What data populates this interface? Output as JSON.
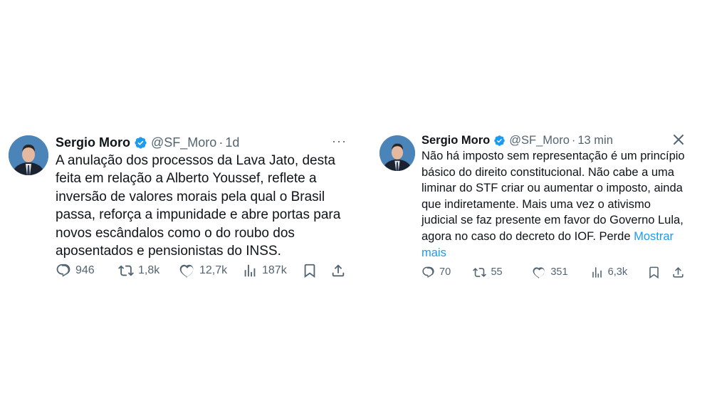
{
  "tweets": [
    {
      "author": {
        "name": "Sergio Moro",
        "handle": "@SF_Moro",
        "separator": "·",
        "time": "1d",
        "verified": true
      },
      "menu_label": "···",
      "text": "A anulação dos processos da Lava Jato, desta feita em relação a Alberto Youssef, reflete a inversão de valores morais pela qual o Brasil passa, reforça a impunidade e abre portas para novos escândalos como o do roubo dos aposentados e pensionistas do INSS.",
      "stats": {
        "replies": "946",
        "reposts": "1,8k",
        "likes": "12,7k",
        "views": "187k"
      }
    },
    {
      "author": {
        "name": "Sergio Moro",
        "handle": "@SF_Moro",
        "separator": "·",
        "time": "13 min",
        "verified": true
      },
      "close_icon": "close-icon",
      "text": "Não há imposto sem representação é um princípio básico do direito constitucional. Não cabe a uma liminar do STF criar ou aumentar o imposto, ainda que indiretamente. Mais uma vez o ativismo judicial se faz presente em favor do Governo Lula, agora no caso do decreto do IOF. Perde",
      "show_more": "Mostrar mais",
      "stats": {
        "replies": "70",
        "reposts": "55",
        "likes": "351",
        "views": "6,3k"
      }
    }
  ],
  "colors": {
    "text": "#0f1419",
    "secondary": "#536471",
    "verified": "#1d9bf0",
    "link": "#1d9bf0",
    "background": "#ffffff"
  },
  "icons": [
    "reply-icon",
    "repost-icon",
    "like-icon",
    "views-icon",
    "bookmark-icon",
    "share-icon",
    "verified-badge-icon",
    "more-icon",
    "close-icon"
  ]
}
